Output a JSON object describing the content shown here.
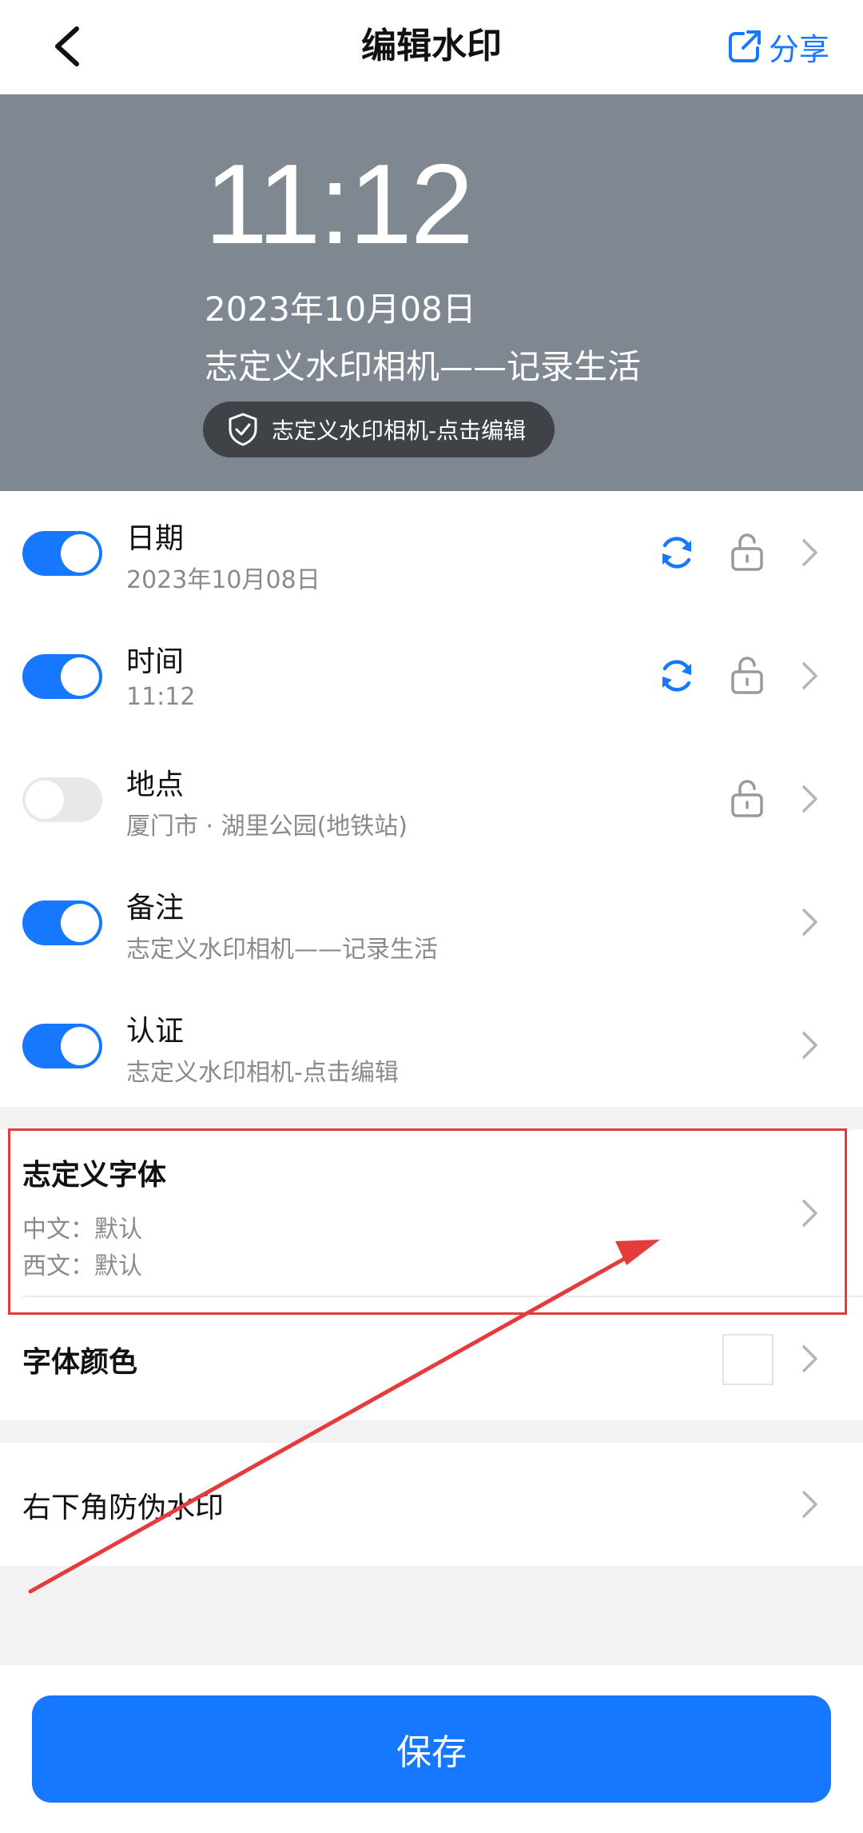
{
  "header": {
    "title": "编辑水印",
    "share_label": "分享"
  },
  "preview": {
    "time": "11:12",
    "date": "2023年10月08日",
    "remark": "志定义水印相机——记录生活",
    "cert": "志定义水印相机-点击编辑"
  },
  "rows": [
    {
      "title": "日期",
      "subtitle": "2023年10月08日",
      "enabled": true,
      "refresh": true,
      "lock": true
    },
    {
      "title": "时间",
      "subtitle": "11:12",
      "enabled": true,
      "refresh": true,
      "lock": true
    },
    {
      "title": "地点",
      "subtitle": "厦门市 · 湖里公园(地铁站)",
      "enabled": false,
      "refresh": false,
      "lock": true
    },
    {
      "title": "备注",
      "subtitle": "志定义水印相机——记录生活",
      "enabled": true,
      "refresh": false,
      "lock": false
    },
    {
      "title": "认证",
      "subtitle": "志定义水印相机-点击编辑",
      "enabled": true,
      "refresh": false,
      "lock": false
    }
  ],
  "font": {
    "title": "志定义字体",
    "zh": "中文：默认",
    "en": "西文：默认"
  },
  "font_color": {
    "title": "字体颜色",
    "swatch": "#ffffff"
  },
  "anti_fake": {
    "title": "右下角防伪水印"
  },
  "save_label": "保存",
  "colors": {
    "accent": "#1677ff",
    "annotation": "#e63b3b",
    "preview_bg": "#7f8791"
  }
}
